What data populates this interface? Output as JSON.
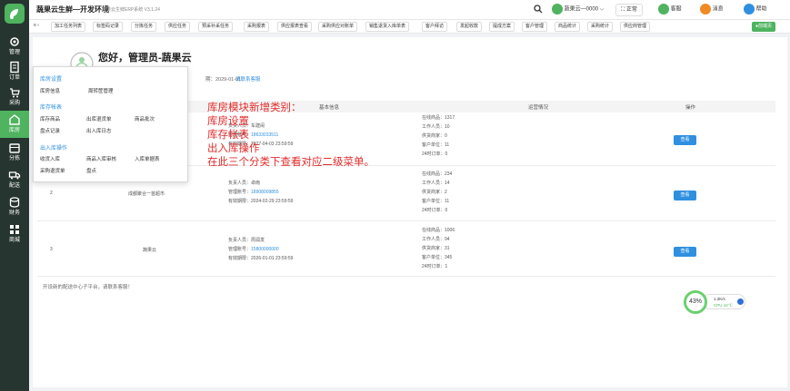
{
  "app": {
    "title": "蔬果云生鲜—开发环境",
    "subtitle": "蔬果云生鲜ERP系统 V3.1.24",
    "user": "蔬果云—0000",
    "btn_normal": "正常",
    "btn_service": "客服",
    "btn_message": "消息",
    "btn_help": "帮助"
  },
  "sidebar": [
    {
      "label": "管理",
      "icon": "gear-icon"
    },
    {
      "label": "订单",
      "icon": "order-icon"
    },
    {
      "label": "采购",
      "icon": "cart-icon"
    },
    {
      "label": "库房",
      "icon": "warehouse-icon"
    },
    {
      "label": "分拣",
      "icon": "sort-icon"
    },
    {
      "label": "配送",
      "icon": "truck-icon"
    },
    {
      "label": "财务",
      "icon": "finance-icon"
    },
    {
      "label": "商城",
      "icon": "shop-icon"
    }
  ],
  "menubar": [
    "加工任务列表",
    "标签码记录",
    "分拣任务",
    "供应任务",
    "预采补采任务",
    "采购报表",
    "供应报表查看",
    "采购供应对账单",
    "销售退货入库单表",
    "客户拜访",
    "发起收款",
    "提成方案",
    "客户管理",
    "商品统计",
    "采购统计",
    "供应商管理",
    "●前端页"
  ],
  "greeting": {
    "title": "您好，管理员-蔬果云",
    "expiry": "期：2029-01-01",
    "contact": "请联系客服"
  },
  "table": {
    "headers": [
      "基本信息",
      "运营情况",
      "操作"
    ],
    "rows": [
      {
        "index": "",
        "name": "",
        "owner_label": "负责人员：",
        "owner": "车建闹",
        "phone_label": "管理账号：",
        "phone": "18633033511",
        "expiry_label": "有效期限：",
        "expiry": "2027-04-03 23:59:59",
        "stats": [
          "在线商品：1317",
          "工作人员：10",
          "供货商家：0",
          "客户单位：11",
          "24时订单：0"
        ],
        "action": "查看"
      },
      {
        "index": "2",
        "name": "成都聚合一首超市",
        "owner_label": "负责人员：",
        "owner": "卓雨",
        "phone_label": "管理账号：",
        "phone": "18908009855",
        "expiry_label": "有效期限：",
        "expiry": "2024-02-29 23:59:59",
        "stats": [
          "在线商品：234",
          "工作人员：14",
          "供货商家：2",
          "客户单位：11",
          "24时订单：0"
        ],
        "action": "查看"
      },
      {
        "index": "3",
        "name": "蔬果云",
        "owner_label": "负责人员：",
        "owner": "周润发",
        "phone_label": "管理账号：",
        "phone": "15800000000",
        "expiry_label": "有效期限：",
        "expiry": "2026-01-01 23:59:59",
        "stats": [
          "在线商品：1006",
          "工作人员：94",
          "供货商家：31",
          "客户单位：345",
          "24时订单：1"
        ],
        "action": "查看"
      }
    ]
  },
  "footnote": "开设新的配送中心子平台，请联系客服！",
  "dropdown": {
    "groups": [
      {
        "title": "库房设置",
        "items": [
          "库房信息",
          "周转筐管理"
        ]
      },
      {
        "title": "库存帐表",
        "items": [
          "库存商品",
          "出库退货单",
          "商品批次",
          "盘点记录",
          "出入库日志"
        ]
      },
      {
        "title": "出入库操作",
        "items": [
          "收货入库",
          "商品入库审核",
          "入库单据表",
          "采购退货单",
          "盘点"
        ]
      }
    ]
  },
  "annotation": [
    "库房模块新增类别：",
    "库房设置",
    "库存帐表",
    "出入库操作",
    "在此三个分类下查看对应二级菜单。"
  ],
  "gauge": {
    "percent": "43%",
    "net": "1.2K/s",
    "cpu": "CPU 44℃"
  }
}
